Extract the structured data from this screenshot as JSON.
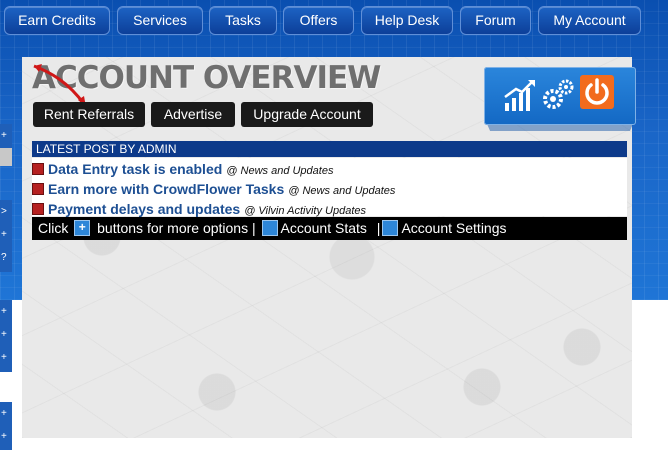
{
  "nav": {
    "items": [
      {
        "label": "Earn Credits"
      },
      {
        "label": "Services"
      },
      {
        "label": "Tasks"
      },
      {
        "label": "Offers"
      },
      {
        "label": "Help Desk"
      },
      {
        "label": "Forum"
      },
      {
        "label": "My Account"
      }
    ]
  },
  "page": {
    "title": "ACCOUNT OVERVIEW"
  },
  "actions": {
    "rent_referrals": "Rent Referrals",
    "advertise": "Advertise",
    "upgrade_account": "Upgrade Account"
  },
  "icons": {
    "stats": "stats-chart-icon",
    "settings": "gears-icon",
    "logout": "power-icon"
  },
  "latest_post": {
    "header": "LATEST POST BY ADMIN",
    "posts": [
      {
        "title": "Data Entry task is enabled",
        "category": "@ News and Updates"
      },
      {
        "title": "Earn more with CrowdFlower Tasks",
        "category": "@ News and Updates"
      },
      {
        "title": "Payment delays and updates",
        "category": "@ Vilvin Activity Updates"
      }
    ]
  },
  "help_bar": {
    "click": "Click",
    "buttons_text": "buttons for more options |",
    "account_stats": "Account Stats",
    "separator": "|",
    "account_settings": "Account Settings"
  },
  "colors": {
    "accent_blue": "#0c3f99",
    "logout_orange": "#f26b1d",
    "header_navy": "#0d3a8a"
  }
}
